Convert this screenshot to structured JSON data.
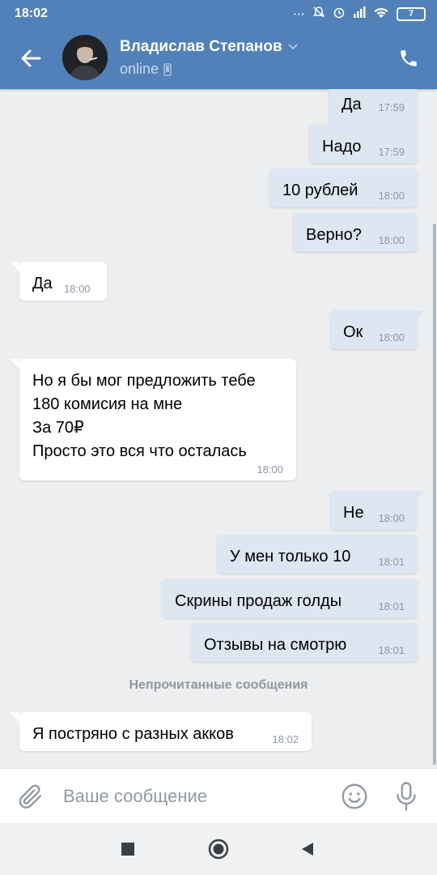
{
  "status_bar": {
    "time": "18:02",
    "battery": "7"
  },
  "header": {
    "name": "Владислав Степанов",
    "status": "online"
  },
  "messages": [
    {
      "dir": "out",
      "text": "Да",
      "time": "17:59"
    },
    {
      "dir": "out",
      "text": "Надо",
      "time": "17:59"
    },
    {
      "dir": "out",
      "text": "10 рублей",
      "time": "18:00"
    },
    {
      "dir": "out",
      "text": "Верно?",
      "time": "18:00"
    },
    {
      "dir": "in",
      "text": "Да",
      "time": "18:00"
    },
    {
      "dir": "out",
      "text": "Ок",
      "time": "18:00"
    },
    {
      "dir": "in",
      "text": "Но я бы мог предложить тебе\n180 комисия на мне\nЗа 70₽\nПросто это вся что осталась",
      "time": "18:00"
    },
    {
      "dir": "out",
      "text": "Не",
      "time": "18:00"
    },
    {
      "dir": "out",
      "text": "У мен только 10",
      "time": "18:01"
    },
    {
      "dir": "out",
      "text": "Скрины продаж голды",
      "time": "18:01"
    },
    {
      "dir": "out",
      "text": "Отзывы на смотрю",
      "time": "18:01"
    },
    {
      "dir": "in",
      "text": "Я постряно с разных акков",
      "time": "18:02"
    }
  ],
  "unread_divider": "Непрочитанные сообщения",
  "composer": {
    "placeholder": "Ваше сообщение"
  },
  "colors": {
    "header": "#5181b8",
    "outgoing_bubble": "#dde6f1",
    "incoming_bubble": "#ffffff",
    "background": "#edeef0"
  }
}
